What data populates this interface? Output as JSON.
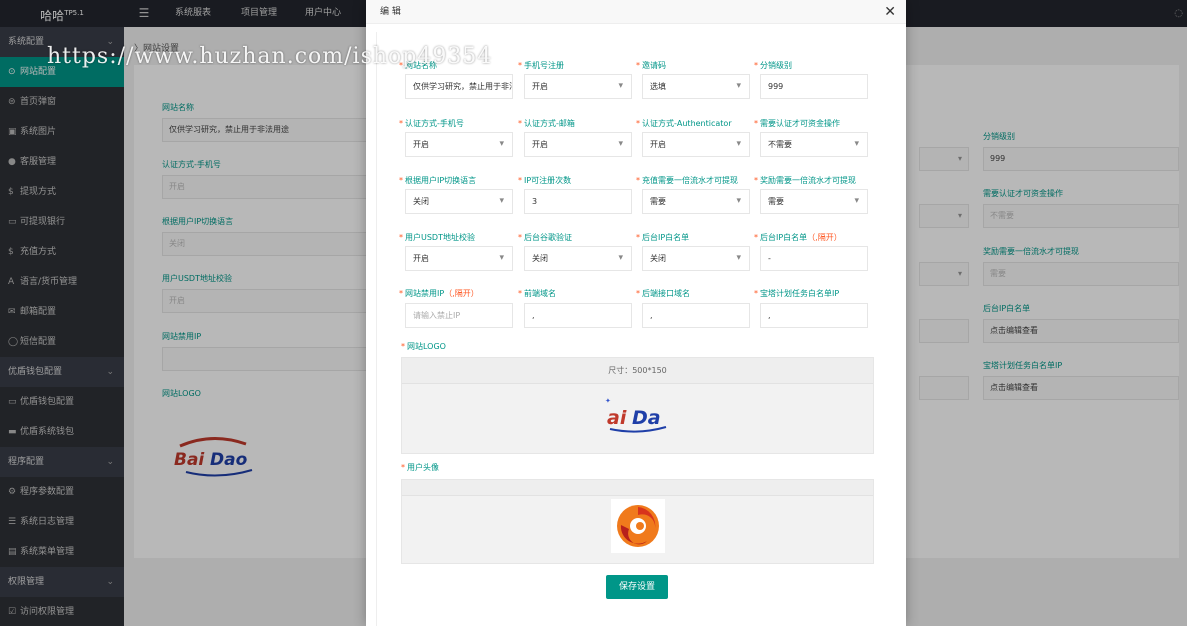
{
  "header": {
    "logo": "哈哈",
    "logo_sup": "TP5.1",
    "menu_icon": "menu-icon",
    "nav": [
      "系统服表",
      "项目管理",
      "用户中心"
    ]
  },
  "sidebar": {
    "items": [
      {
        "type": "group",
        "label": "系统配置"
      },
      {
        "type": "item",
        "icon": "⊙",
        "label": "网站配置",
        "active": true
      },
      {
        "type": "item",
        "icon": "⊜",
        "label": "首页弹窗"
      },
      {
        "type": "item",
        "icon": "▣",
        "label": "系统图片"
      },
      {
        "type": "item",
        "icon": "●",
        "label": "客服管理"
      },
      {
        "type": "item",
        "icon": "$",
        "label": "提现方式"
      },
      {
        "type": "item",
        "icon": "▭",
        "label": "可提现银行"
      },
      {
        "type": "item",
        "icon": "$",
        "label": "充值方式"
      },
      {
        "type": "item",
        "icon": "A",
        "label": "语言/货币管理"
      },
      {
        "type": "item",
        "icon": "✉",
        "label": "邮箱配置"
      },
      {
        "type": "item",
        "icon": "◯",
        "label": "短信配置"
      },
      {
        "type": "group",
        "label": "优盾钱包配置"
      },
      {
        "type": "item",
        "icon": "▭",
        "label": "优盾钱包配置"
      },
      {
        "type": "item",
        "icon": "▬",
        "label": "优盾系统钱包"
      },
      {
        "type": "group",
        "label": "程序配置"
      },
      {
        "type": "item",
        "icon": "⚙",
        "label": "程序参数配置"
      },
      {
        "type": "item",
        "icon": "☰",
        "label": "系统日志管理"
      },
      {
        "type": "item",
        "icon": "▤",
        "label": "系统菜单管理"
      },
      {
        "type": "group",
        "label": "权限管理"
      },
      {
        "type": "item",
        "icon": "☑",
        "label": "访问权限管理"
      }
    ]
  },
  "breadcrumb": "网站设置",
  "background_form": {
    "left_fields": [
      {
        "label": "网站名称",
        "value": "仅供学习研究，禁止用于非法用途"
      },
      {
        "label": "认证方式-手机号",
        "value": "开启"
      },
      {
        "label": "根据用户IP切换语言",
        "value": "关闭"
      },
      {
        "label": "用户USDT地址校验",
        "value": "开启"
      },
      {
        "label": "网站禁用IP",
        "value": ""
      }
    ],
    "logo_label": "网站LOGO",
    "right_fields": [
      {
        "label": "分销级别",
        "value": "999"
      },
      {
        "label": "需要认证才可资金操作",
        "value": "不需要"
      },
      {
        "label": "奖励需要一倍流水才可提现",
        "value": "需要"
      },
      {
        "label": "后台IP白名单",
        "value": "点击编辑查看"
      },
      {
        "label": "宝塔计划任务白名单IP",
        "value": "点击编辑查看"
      }
    ]
  },
  "modal": {
    "title": "编 辑",
    "close_icon": "close-icon",
    "rows": [
      [
        {
          "label": "网站名称",
          "value": "仅供学习研究，禁止用于非法",
          "select": false,
          "placeholder": false
        },
        {
          "label": "手机号注册",
          "value": "开启",
          "select": true,
          "placeholder": false
        },
        {
          "label": "邀请码",
          "value": "选填",
          "select": true,
          "placeholder": false
        },
        {
          "label": "分销级别",
          "value": "999",
          "select": false,
          "placeholder": false
        }
      ],
      [
        {
          "label": "认证方式-手机号",
          "value": "开启",
          "select": true,
          "placeholder": false
        },
        {
          "label": "认证方式-邮箱",
          "value": "开启",
          "select": true,
          "placeholder": false
        },
        {
          "label": "认证方式-Authenticator",
          "value": "开启",
          "select": true,
          "placeholder": false
        },
        {
          "label": "需要认证才可资金操作",
          "value": "不需要",
          "select": true,
          "placeholder": false
        }
      ],
      [
        {
          "label": "根据用户IP切换语言",
          "value": "关闭",
          "select": true,
          "placeholder": false
        },
        {
          "label": "IP可注册次数",
          "value": "3",
          "select": false,
          "placeholder": false
        },
        {
          "label": "充值需要一倍流水才可提现",
          "value": "需要",
          "select": true,
          "placeholder": false
        },
        {
          "label": "奖励需要一倍流水才可提现",
          "value": "需要",
          "select": true,
          "placeholder": false
        }
      ],
      [
        {
          "label": "用户USDT地址校验",
          "value": "开启",
          "select": true,
          "placeholder": false
        },
        {
          "label": "后台谷歌验证",
          "value": "关闭",
          "select": true,
          "placeholder": false
        },
        {
          "label": "后台IP白名单",
          "value": "关闭",
          "select": true,
          "placeholder": false
        },
        {
          "label": "后台IP白名单",
          "suffix": "（,隔开）",
          "value": "-",
          "select": false,
          "placeholder": false
        }
      ],
      [
        {
          "label": "网站禁用IP",
          "suffix": "（,隔开）",
          "value": "请输入禁止IP",
          "select": false,
          "placeholder": true
        },
        {
          "label": "前端域名",
          "value": ",",
          "select": false,
          "placeholder": false
        },
        {
          "label": "后端接口域名",
          "value": ",",
          "select": false,
          "placeholder": false
        },
        {
          "label": "宝塔计划任务白名单IP",
          "value": ",",
          "select": false,
          "placeholder": false
        }
      ]
    ],
    "logo_label": "网站LOGO",
    "logo_size_text": "尺寸：500*150",
    "avatar_label": "用户头像",
    "save_label": "保存设置"
  },
  "watermark": "https://www.huzhan.com/ishop49354",
  "colors": {
    "accent": "#009688",
    "required": "#ff5722",
    "sidebar": "#2f3136",
    "topbar": "#23262e"
  }
}
